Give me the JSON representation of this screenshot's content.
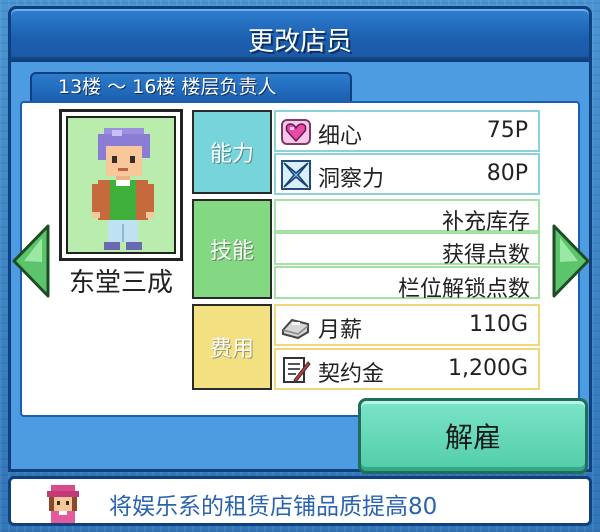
{
  "header": {
    "title": "更改店员"
  },
  "floor_tab": {
    "label": "13楼 ～ 16楼 楼层负责人"
  },
  "staff": {
    "name": "东堂三成"
  },
  "categories": {
    "ability": "能力",
    "skill": "技能",
    "cost": "费用"
  },
  "abilities": [
    {
      "name": "细心",
      "value": "75P",
      "icon": "heart-icon"
    },
    {
      "name": "洞察力",
      "value": "80P",
      "icon": "insight-icon"
    }
  ],
  "skills": [
    "补充库存",
    "获得点数",
    "栏位解锁点数"
  ],
  "costs": [
    {
      "name": "月薪",
      "value": "110G",
      "icon": "silver-icon"
    },
    {
      "name": "契约金",
      "value": "1,200G",
      "icon": "contract-icon"
    }
  ],
  "buttons": {
    "dismiss": "解雇"
  },
  "message": {
    "text": "将娱乐系的租赁店铺品质提高80"
  },
  "colors": {
    "title_bar": "#1c5fb0",
    "ability_cell": "#77d4da",
    "skill_cell": "#84d884",
    "cost_cell": "#f3e181",
    "dismiss_button": "#52cda9",
    "arrow": "#5cc46a",
    "message_text": "#2a64b0"
  }
}
